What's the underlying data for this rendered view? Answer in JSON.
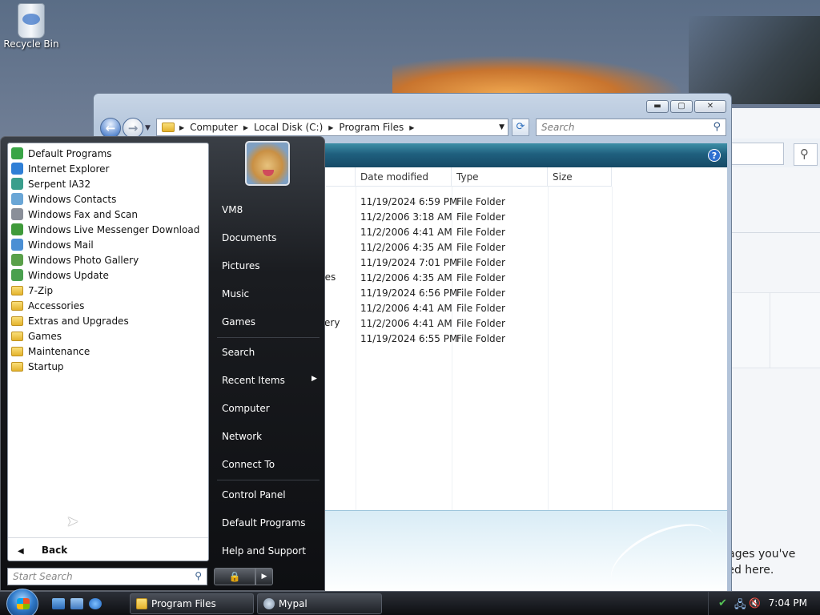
{
  "desktop": {
    "recycle_bin_label": "Recycle Bin"
  },
  "explorer": {
    "address": [
      "Computer",
      "Local Disk (C:)",
      "Program Files"
    ],
    "search_placeholder": "Search",
    "columns": {
      "date": "Date modified",
      "type": "Type",
      "size": "Size"
    },
    "rows": [
      {
        "date": "11/19/2024 6:59 PM",
        "type": "File Folder"
      },
      {
        "date": "11/2/2006 3:18 AM",
        "type": "File Folder"
      },
      {
        "date": "11/2/2006 4:41 AM",
        "type": "File Folder"
      },
      {
        "date": "11/2/2006 4:35 AM",
        "type": "File Folder"
      },
      {
        "date": "11/19/2024 7:01 PM",
        "type": "File Folder"
      },
      {
        "date": "11/2/2006 4:35 AM",
        "type": "File Folder"
      },
      {
        "date": "11/19/2024 6:56 PM",
        "type": "File Folder"
      },
      {
        "date": "11/2/2006 4:41 AM",
        "type": "File Folder"
      },
      {
        "date": "11/2/2006 4:41 AM",
        "type": "File Folder"
      },
      {
        "date": "11/19/2024 6:55 PM",
        "type": "File Folder"
      }
    ],
    "partial_names": {
      "row6": "lies",
      "row9": "allery"
    }
  },
  "ie_background": {
    "text": "reat articles, videos, and other pages you've recently visited or bookmarked here."
  },
  "start_menu": {
    "programs": [
      {
        "label": "Default Programs",
        "icon": "default-programs-icon",
        "color": "#3aa547"
      },
      {
        "label": "Internet Explorer",
        "icon": "internet-explorer-icon",
        "color": "#2f7fd6"
      },
      {
        "label": "Serpent IA32",
        "icon": "serpent-icon",
        "color": "#3a9e8c"
      },
      {
        "label": "Windows Contacts",
        "icon": "contacts-icon",
        "color": "#6aa6d6"
      },
      {
        "label": "Windows Fax and Scan",
        "icon": "fax-scan-icon",
        "color": "#8a8f99"
      },
      {
        "label": "Windows Live Messenger Download",
        "icon": "messenger-icon",
        "color": "#3f9a3a"
      },
      {
        "label": "Windows Mail",
        "icon": "mail-icon",
        "color": "#4b8fd4"
      },
      {
        "label": "Windows Photo Gallery",
        "icon": "photo-gallery-icon",
        "color": "#5aa04a"
      },
      {
        "label": "Windows Update",
        "icon": "windows-update-icon",
        "color": "#4aa04f"
      },
      {
        "label": "7-Zip",
        "icon": "folder-icon",
        "color": "folder"
      },
      {
        "label": "Accessories",
        "icon": "folder-icon",
        "color": "folder"
      },
      {
        "label": "Extras and Upgrades",
        "icon": "folder-icon",
        "color": "folder"
      },
      {
        "label": "Games",
        "icon": "folder-icon",
        "color": "folder"
      },
      {
        "label": "Maintenance",
        "icon": "folder-icon",
        "color": "folder"
      },
      {
        "label": "Startup",
        "icon": "folder-icon",
        "color": "folder"
      }
    ],
    "back_label": "Back",
    "search_placeholder": "Start Search",
    "right_items": {
      "user": "VM8",
      "documents": "Documents",
      "pictures": "Pictures",
      "music": "Music",
      "games": "Games",
      "search": "Search",
      "recent": "Recent Items",
      "computer": "Computer",
      "network": "Network",
      "connect": "Connect To",
      "control_panel": "Control Panel",
      "default_programs": "Default Programs",
      "help": "Help and Support"
    }
  },
  "taskbar": {
    "buttons": [
      {
        "label": "Program Files",
        "icon": "folder-icon"
      },
      {
        "label": "Mypal",
        "icon": "mypal-icon"
      }
    ],
    "clock": "7:04 PM"
  }
}
